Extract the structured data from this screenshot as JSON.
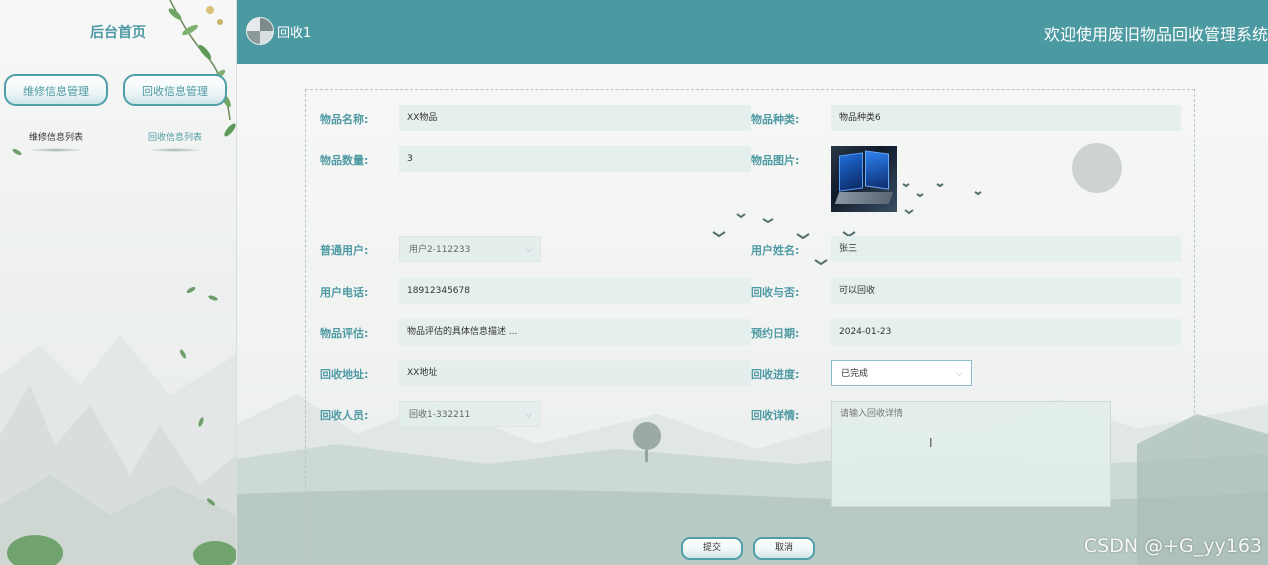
{
  "sidebar": {
    "home_title": "后台首页",
    "menus": [
      {
        "label": "维修信息管理",
        "sub": "维修信息列表"
      },
      {
        "label": "回收信息管理",
        "sub": "回收信息列表"
      }
    ]
  },
  "header": {
    "username": "回收1",
    "welcome": "欢迎使用废旧物品回收管理系统"
  },
  "form": {
    "item_name": {
      "label": "物品名称:",
      "value": "XX物品"
    },
    "item_type": {
      "label": "物品种类:",
      "value": "物品种类6"
    },
    "item_qty": {
      "label": "物品数量:",
      "value": "3"
    },
    "item_image": {
      "label": "物品图片:"
    },
    "user": {
      "label": "普通用户:",
      "value": "用户2-112233"
    },
    "user_name": {
      "label": "用户姓名:",
      "value": "张三"
    },
    "user_phone": {
      "label": "用户电话:",
      "value": "18912345678"
    },
    "recyclable": {
      "label": "回收与否:",
      "value": "可以回收"
    },
    "evaluation": {
      "label": "物品评估:",
      "value": "物品评估的具体信息描述 ..."
    },
    "appointment_date": {
      "label": "预约日期:",
      "value": "2024-01-23"
    },
    "address": {
      "label": "回收地址:",
      "value": "XX地址"
    },
    "progress": {
      "label": "回收进度:",
      "value": "已完成"
    },
    "staff": {
      "label": "回收人员:",
      "value": "回收1-332211"
    },
    "details": {
      "label": "回收详情:",
      "placeholder": "请输入回收详情"
    }
  },
  "buttons": {
    "submit": "提交",
    "cancel": "取消"
  },
  "watermark": "CSDN @+G_yy163",
  "colors": {
    "accent": "#4c9aa1",
    "label": "#4f9aa4"
  },
  "icons": {
    "avatar": "avatar-icon",
    "select_caret": "chevron-down-icon",
    "text_cursor": "ibeam-cursor-icon"
  }
}
